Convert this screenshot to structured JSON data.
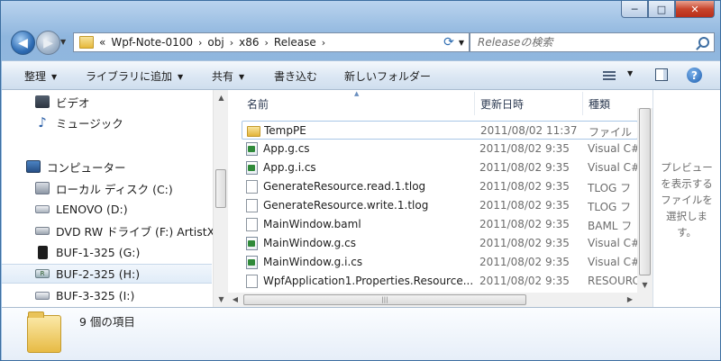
{
  "window": {
    "caption_buttons": {
      "minimize": "─",
      "maximize": "□",
      "close": "✕"
    }
  },
  "address": {
    "overflow": "«",
    "crumbs": [
      "Wpf-Note-0100",
      "obj",
      "x86",
      "Release"
    ],
    "separator": "›"
  },
  "search": {
    "placeholder": "Releaseの検索"
  },
  "toolbar": {
    "organize": "整理",
    "library": "ライブラリに追加",
    "share": "共有",
    "burn": "書き込む",
    "new_folder": "新しいフォルダー"
  },
  "sidebar": {
    "items": [
      {
        "label": "ビデオ",
        "icon": "video-library-icon"
      },
      {
        "label": "ミュージック",
        "icon": "music-library-icon"
      },
      {
        "label": "コンピューター",
        "icon": "computer-icon"
      },
      {
        "label": "ローカル ディスク (C:)",
        "icon": "local-disk-icon"
      },
      {
        "label": "LENOVO (D:)",
        "icon": "drive-icon"
      },
      {
        "label": "DVD RW ドライブ (F:) ArtistX",
        "icon": "dvd-drive-icon"
      },
      {
        "label": "BUF-1-325 (G:)",
        "icon": "removable-drive-icon"
      },
      {
        "label": "BUF-2-325 (H:)",
        "icon": "usb-drive-icon"
      },
      {
        "label": "BUF-3-325 (I:)",
        "icon": "drive-icon"
      }
    ]
  },
  "filelist": {
    "columns": {
      "name": "名前",
      "date": "更新日時",
      "type": "種類"
    },
    "rows": [
      {
        "name": "TempPE",
        "date": "2011/08/02 11:37",
        "type": "ファイル",
        "icon": "folder-icon"
      },
      {
        "name": "App.g.cs",
        "date": "2011/08/02 9:35",
        "type": "Visual C#",
        "icon": "cs-file-icon"
      },
      {
        "name": "App.g.i.cs",
        "date": "2011/08/02 9:35",
        "type": "Visual C#",
        "icon": "cs-file-icon"
      },
      {
        "name": "GenerateResource.read.1.tlog",
        "date": "2011/08/02 9:35",
        "type": "TLOG フ",
        "icon": "file-icon"
      },
      {
        "name": "GenerateResource.write.1.tlog",
        "date": "2011/08/02 9:35",
        "type": "TLOG フ",
        "icon": "file-icon"
      },
      {
        "name": "MainWindow.baml",
        "date": "2011/08/02 9:35",
        "type": "BAML フ",
        "icon": "file-icon"
      },
      {
        "name": "MainWindow.g.cs",
        "date": "2011/08/02 9:35",
        "type": "Visual C#",
        "icon": "cs-file-icon"
      },
      {
        "name": "MainWindow.g.i.cs",
        "date": "2011/08/02 9:35",
        "type": "Visual C#",
        "icon": "cs-file-icon"
      },
      {
        "name": "WpfApplication1.Properties.Resource...",
        "date": "2011/08/02 9:35",
        "type": "RESOURC",
        "icon": "file-icon"
      }
    ]
  },
  "preview": {
    "message": "プレビューを表示するファイルを選択します。"
  },
  "details": {
    "item_count": "9 個の項目"
  }
}
